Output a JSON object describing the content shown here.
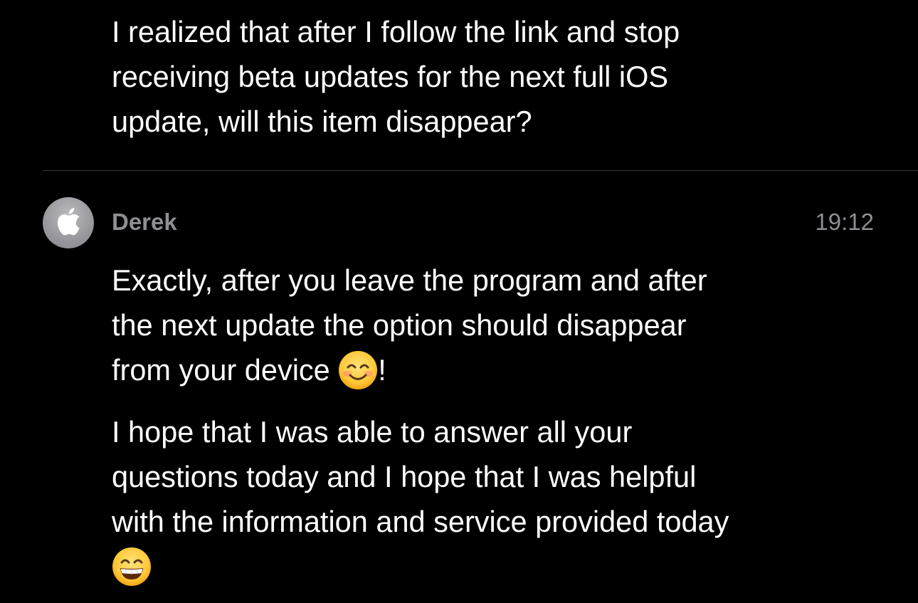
{
  "previous_message": {
    "lines": [
      "I realized that after I follow the link and stop",
      "receiving beta updates for the next full iOS",
      "update, will this item disappear?"
    ]
  },
  "reply": {
    "sender": "Derek",
    "time": "19:12",
    "avatar_icon": "apple-logo-icon",
    "paragraph1": {
      "lines": [
        "Exactly, after you leave the program and after",
        "the next update the option should disappear",
        "from your device "
      ],
      "emoji": "smiling-face-with-smiling-eyes",
      "suffix": "!"
    },
    "paragraph2": {
      "lines": [
        "I hope that I was able to answer all your",
        "questions today and I hope that I was helpful",
        "with the information and service provided today"
      ],
      "emoji": "beaming-face-with-smiling-eyes"
    }
  },
  "colors": {
    "background": "#000000",
    "text": "#ffffff",
    "secondary_text": "#8e8e93",
    "divider": "#38383a",
    "avatar": "#98989d"
  }
}
